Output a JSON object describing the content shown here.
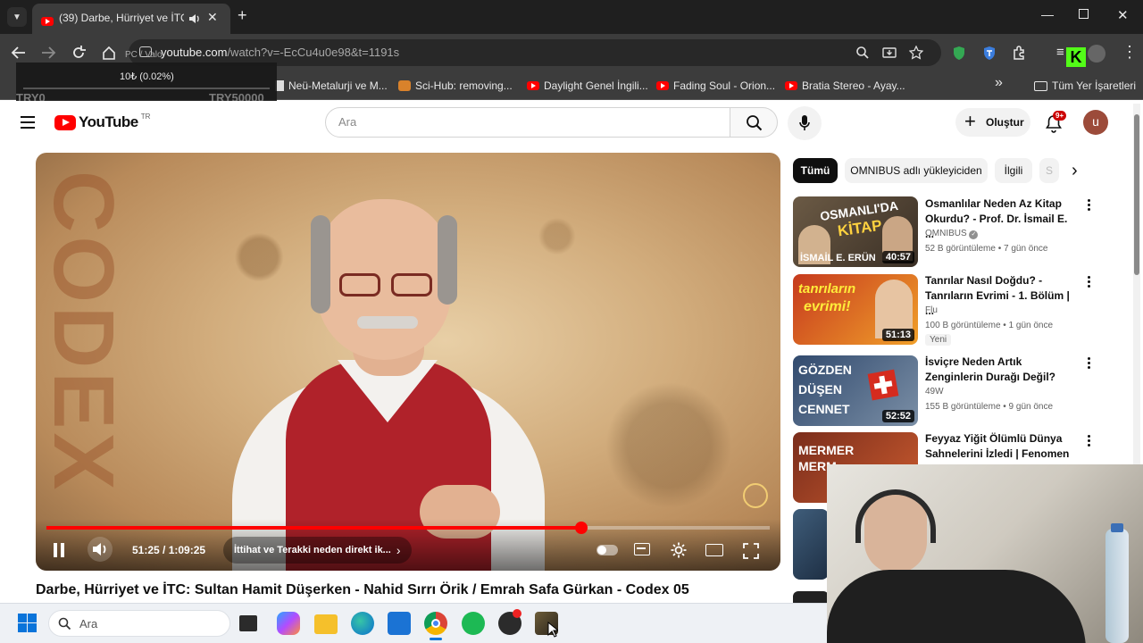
{
  "browser": {
    "tab_title": "(39) Darbe, Hürriyet ve İTC:",
    "new_tab_symbol": "+",
    "url_host": "youtube.com",
    "url_path": "/watch?v=-EcCu4u0e98&t=1191s",
    "bookmarks": [
      {
        "label": "Neü-Metalurji ve M...",
        "icon": "page-icon"
      },
      {
        "label": "Sci-Hub: removing...",
        "icon": "scihub-icon"
      },
      {
        "label": "Daylight Genel İngili...",
        "icon": "youtube-icon"
      },
      {
        "label": "Fading Soul - Orion...",
        "icon": "youtube-icon"
      },
      {
        "label": "Bratia Stereo - Ayay...",
        "icon": "youtube-icon"
      }
    ],
    "all_bookmarks_label": "Tüm Yer İşaretleri",
    "more_symbol": "»"
  },
  "ticker": {
    "left_label": "TRY0",
    "right_label": "TRY50000",
    "percent_text": "10₺ (0.02%)",
    "hint_text": "PC / Valo"
  },
  "youtube": {
    "logo_text": "YouTube",
    "region": "TR",
    "search_placeholder": "Ara",
    "create_label": "Oluştur",
    "notifications_badge": "9+",
    "avatar_letter": "u"
  },
  "player": {
    "time_text": "51:25 / 1:09:25",
    "chapter_text": "İttihat ve Terakki neden direkt ik...",
    "progress": 0.74,
    "brand_text": "CODEX"
  },
  "video_title": "Darbe, Hürriyet ve İTC: Sultan Hamit Düşerken - Nahid Sırrı Örik / Emrah Safa Gürkan - Codex 05",
  "chips": [
    {
      "label": "Tümü",
      "active": true
    },
    {
      "label": "OMNIBUS adlı yükleyiciden",
      "active": false
    },
    {
      "label": "İlgili",
      "active": false
    },
    {
      "label": "S",
      "active": false
    }
  ],
  "recommendations": [
    {
      "title": "Osmanlılar Neden Az Kitap Okurdu? - Prof. Dr. İsmail E. ...",
      "channel": "OMNIBUS",
      "verified": true,
      "meta": "52 B görüntüleme • 7 gün önce",
      "duration": "40:57",
      "thumb_text_top": "OSMANLI'DA",
      "thumb_text_mid": "KİTAP",
      "thumb_text_bottom": "İSMAİL E. ERÜN",
      "badge": ""
    },
    {
      "title": "Tanrılar Nasıl Doğdu? - Tanrıların Evrimi - 1. Bölüm | ...",
      "channel": "Flu",
      "verified": false,
      "meta": "100 B görüntüleme • 1 gün önce",
      "duration": "51:13",
      "thumb_text_top": "tanrıların",
      "thumb_text_mid": "evrimi!",
      "thumb_text_bottom": "",
      "badge": "Yeni"
    },
    {
      "title": "İsviçre Neden Artık Zenginlerin Durağı Değil?",
      "channel": "49W",
      "verified": false,
      "meta": "155 B görüntüleme • 9 gün önce",
      "duration": "52:52",
      "thumb_text_top": "GÖZDEN",
      "thumb_text_mid": "DÜŞEN",
      "thumb_text_bottom": "CENNET",
      "badge": ""
    },
    {
      "title": "Feyyaz Yiğit Ölümlü Dünya Sahnelerini İzledi | Fenomen ...",
      "channel": "",
      "verified": false,
      "meta": "",
      "duration": "",
      "thumb_text_top": "MERMER",
      "thumb_text_mid": "MERM",
      "thumb_text_bottom": "",
      "badge": ""
    }
  ],
  "taskbar": {
    "search_placeholder": "Ara"
  },
  "colors": {
    "youtube_red": "#ff0000",
    "chrome_dark": "#3c3c3c",
    "taskbar_bg": "#eef1f5"
  }
}
